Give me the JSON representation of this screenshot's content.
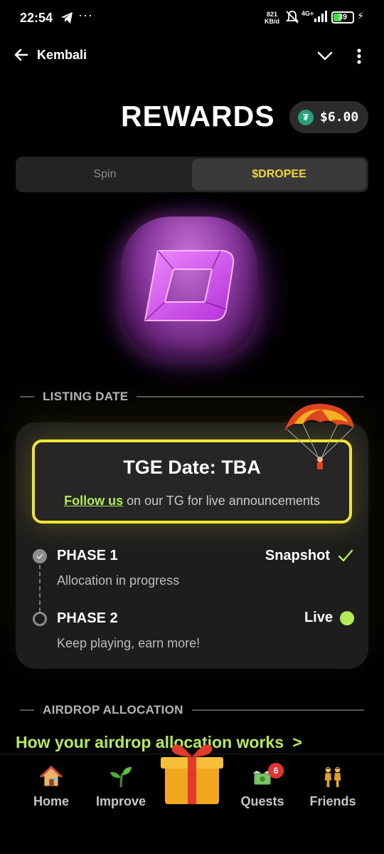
{
  "status_bar": {
    "time": "22:54",
    "speed_value": "821",
    "speed_unit": "KB/d",
    "network": "4G+",
    "battery": "39",
    "battery_level": 0.39,
    "icons": [
      "telegram-icon",
      "more-dots-icon",
      "mute-icon",
      "signal-icon",
      "battery-icon",
      "charging-icon"
    ]
  },
  "topnav": {
    "back_label": "Kembali"
  },
  "header": {
    "title": "REWARDS",
    "balance": "$6.00",
    "balance_icon": "usdt-icon"
  },
  "tabs": [
    {
      "label": "Spin",
      "active": false
    },
    {
      "label": "$DROPEE",
      "active": true
    }
  ],
  "listing": {
    "section_label": "LISTING DATE",
    "tge_title": "TGE Date: TBA",
    "follow_link": "Follow us",
    "follow_rest": " on our TG for live announcements",
    "phases": [
      {
        "name": "PHASE 1",
        "desc": "Allocation in progress",
        "status": "Snapshot",
        "status_icon": "check-icon",
        "done": true
      },
      {
        "name": "PHASE 2",
        "desc": "Keep playing, earn more!",
        "status": "Live",
        "status_icon": "live-dot",
        "done": false
      }
    ]
  },
  "airdrop": {
    "section_label": "AIRDROP ALLOCATION",
    "link_text": "How your airdrop allocation works",
    "chevron": ">"
  },
  "bottom_nav": {
    "items": [
      {
        "label": "Home",
        "icon": "house-icon"
      },
      {
        "label": "Improve",
        "icon": "sprout-icon"
      },
      {
        "label": "",
        "icon": "gift-icon"
      },
      {
        "label": "Quests",
        "icon": "money-wings-icon",
        "badge": "6"
      },
      {
        "label": "Friends",
        "icon": "friends-icon"
      }
    ]
  },
  "colors": {
    "background": "#000000",
    "accent_yellow": "#f0e332",
    "accent_green": "#b3ec52",
    "tab_active_text": "#f2d43b",
    "card": "#1d1d1d",
    "logo_purple": "#b04fd0",
    "badge_red": "#e23434"
  }
}
